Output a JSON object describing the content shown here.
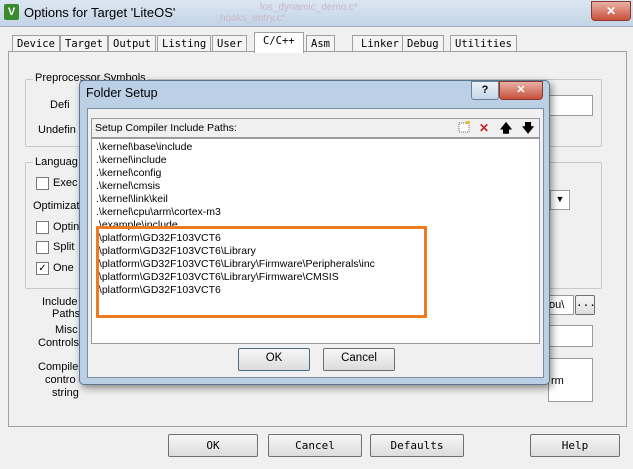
{
  "window": {
    "title": "Options for Target 'LiteOS'",
    "close": "✕",
    "app_icon": "V",
    "bg_text_1": "los_dynamic_demo.c*",
    "bg_text_2": "hooks_entry.c*"
  },
  "tabs": [
    "Device",
    "Target",
    "Output",
    "Listing",
    "User",
    "C/C++",
    "Asm",
    "Linker",
    "Debug",
    "Utilities"
  ],
  "active_tab": "C/C++",
  "preprocessor": {
    "label": "Preprocessor Symbols",
    "define": "Defi",
    "undefine": "Undefin"
  },
  "language": {
    "label": "Languag",
    "execute": "Exec",
    "optimization": "Optimizati",
    "optimize": "Optin",
    "split": "Split",
    "one": "One"
  },
  "include": {
    "label_1": "Include",
    "label_2": "Paths",
    "value": "ou\\",
    "browse": "..."
  },
  "misc": {
    "label_1": "Misc",
    "label_2": "Controls"
  },
  "compiler": {
    "label_1": "Compile",
    "label_2": "contro",
    "label_3": "string",
    "value": "rm"
  },
  "bottom_buttons": {
    "ok": "OK",
    "cancel": "Cancel",
    "defaults": "Defaults",
    "help": "Help"
  },
  "dialog": {
    "title": "Folder Setup",
    "help": "?",
    "close": "✕",
    "list_header": "Setup Compiler Include Paths:",
    "items": [
      ".\\kernel\\base\\include",
      ".\\kernel\\include",
      ".\\kernel\\config",
      ".\\kernel\\cmsis",
      ".\\kernel\\link\\keil",
      ".\\kernel\\cpu\\arm\\cortex-m3",
      ".\\example\\include",
      ".\\platform\\GD32F103VCT6",
      ".\\platform\\GD32F103VCT6\\Library",
      ".\\platform\\GD32F103VCT6\\Library\\Firmware\\Peripherals\\inc",
      ".\\platform\\GD32F103VCT6\\Library\\Firmware\\CMSIS",
      ".\\platform\\GD32F103VCT6"
    ],
    "ok": "OK",
    "cancel": "Cancel",
    "highlight_color": "#f07a20"
  }
}
